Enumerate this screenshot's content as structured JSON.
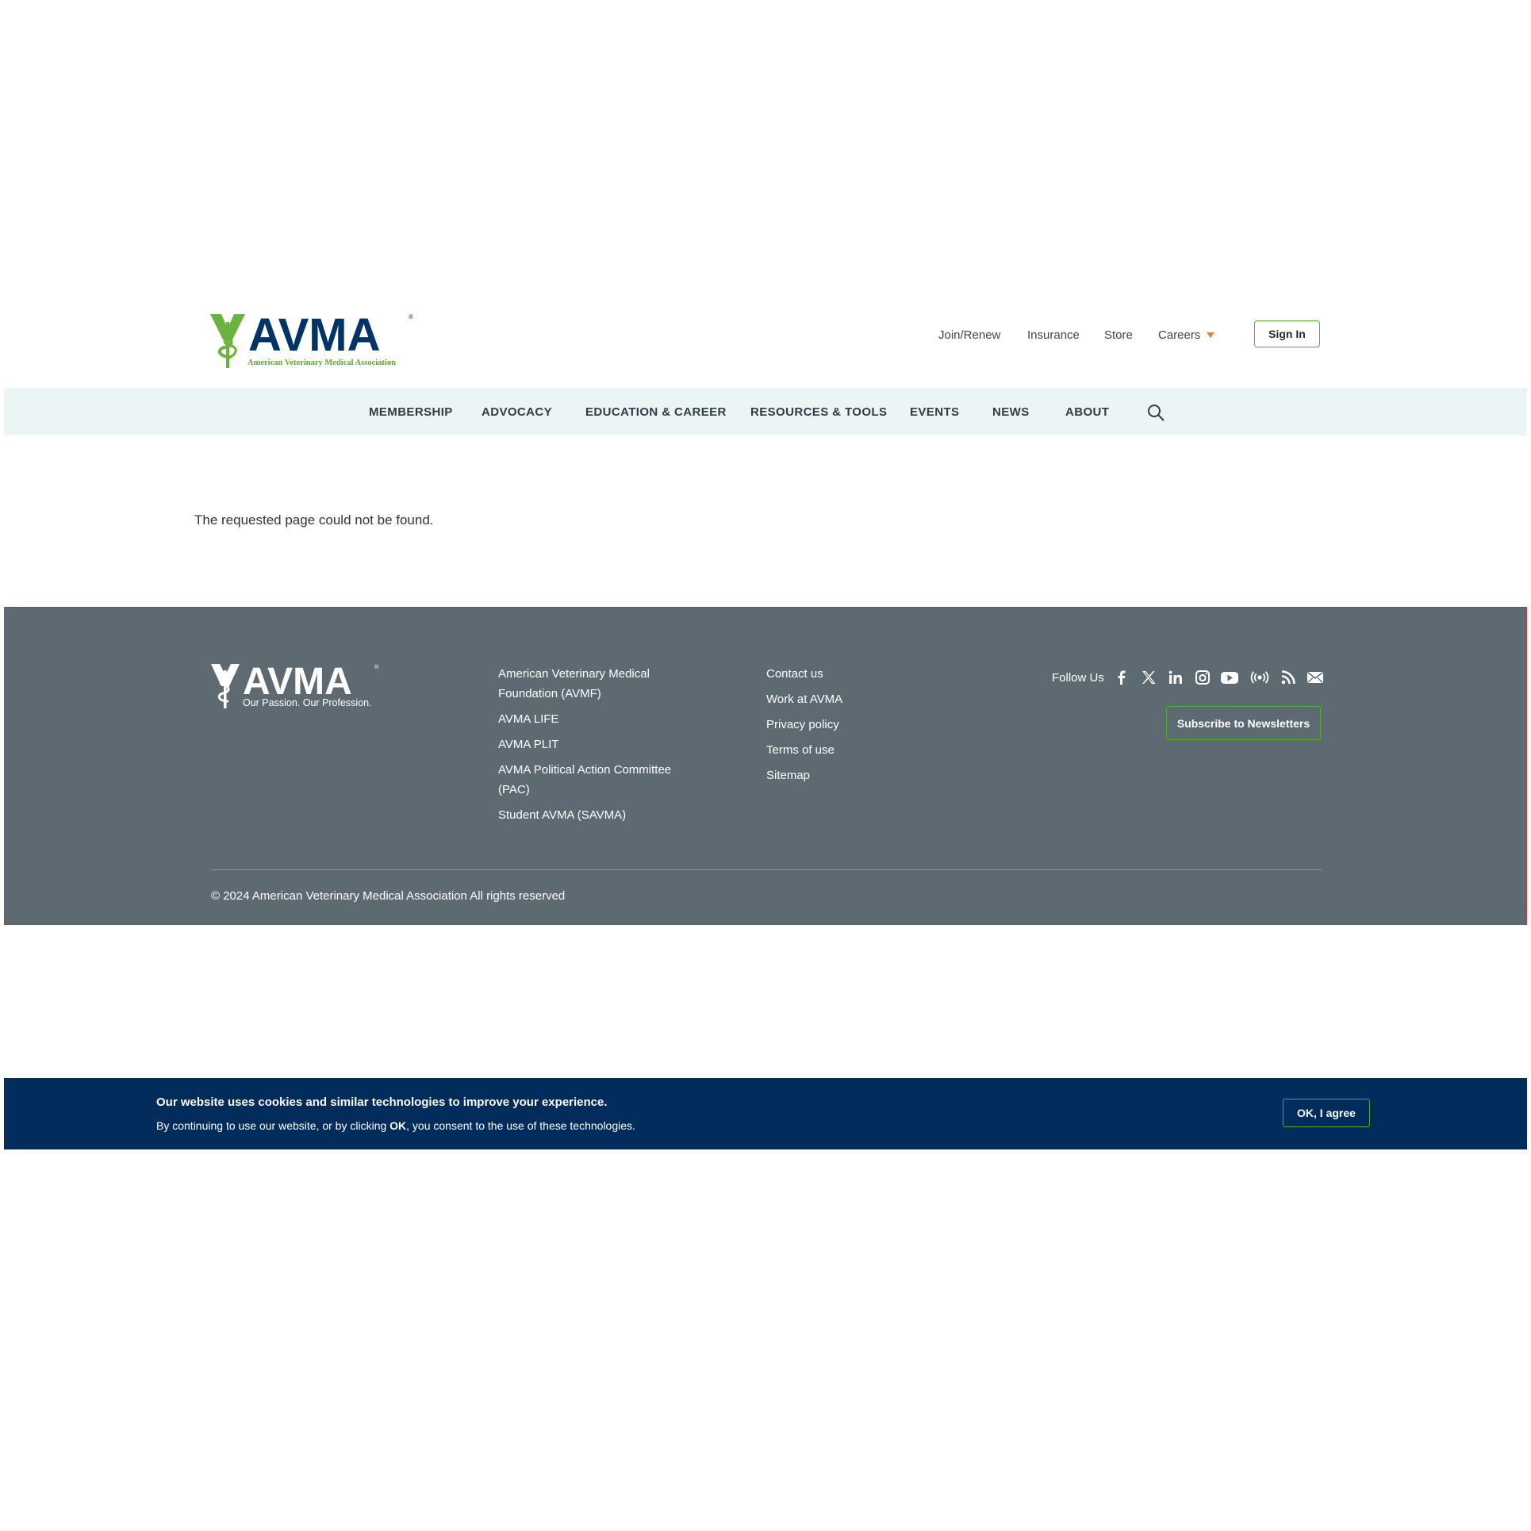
{
  "header": {
    "logo_word": "AVMA",
    "logo_tagline": "American Veterinary Medical Association",
    "utility_links": [
      "Join/Renew",
      "Insurance",
      "Store",
      "Careers"
    ],
    "sign_in_label": "Sign In"
  },
  "main_nav": {
    "items": [
      "MEMBERSHIP",
      "ADVOCACY",
      "EDUCATION & CAREER",
      "RESOURCES & TOOLS",
      "EVENTS",
      "NEWS",
      "ABOUT"
    ]
  },
  "content": {
    "message": "The requested page could not be found."
  },
  "footer": {
    "logo_word": "AVMA",
    "logo_tagline": "Our Passion. Our Profession.",
    "col1": [
      "American Veterinary Medical Foundation (AVMF)",
      "AVMA LIFE",
      "AVMA PLIT",
      "AVMA Political Action Committee (PAC)",
      "Student AVMA (SAVMA)"
    ],
    "col2": [
      "Contact us",
      "Work at AVMA",
      "Privacy policy",
      "Terms of use",
      "Sitemap"
    ],
    "follow_label": "Follow Us",
    "social_icons": [
      "facebook-icon",
      "x-icon",
      "linkedin-icon",
      "instagram-icon",
      "youtube-icon",
      "podcast-icon",
      "rss-icon",
      "email-icon"
    ],
    "subscribe_label": "Subscribe to Newsletters",
    "copyright": "© 2024 American Veterinary Medical Association All rights reserved"
  },
  "cookie_banner": {
    "title": "Our website uses cookies and similar technologies to improve your experience.",
    "text_before": "By continuing to use our website, or by clicking ",
    "text_bold": "OK",
    "text_after": ", you consent to the use of these technologies.",
    "ok_label": "OK, I agree"
  },
  "colors": {
    "brand_navy": "#003366",
    "brand_green": "#5aaa2e",
    "nav_bg": "#ecf5f6",
    "footer_bg": "#5e6a71",
    "cookie_bg": "#022c5c",
    "careers_caret": "#f47b20"
  }
}
